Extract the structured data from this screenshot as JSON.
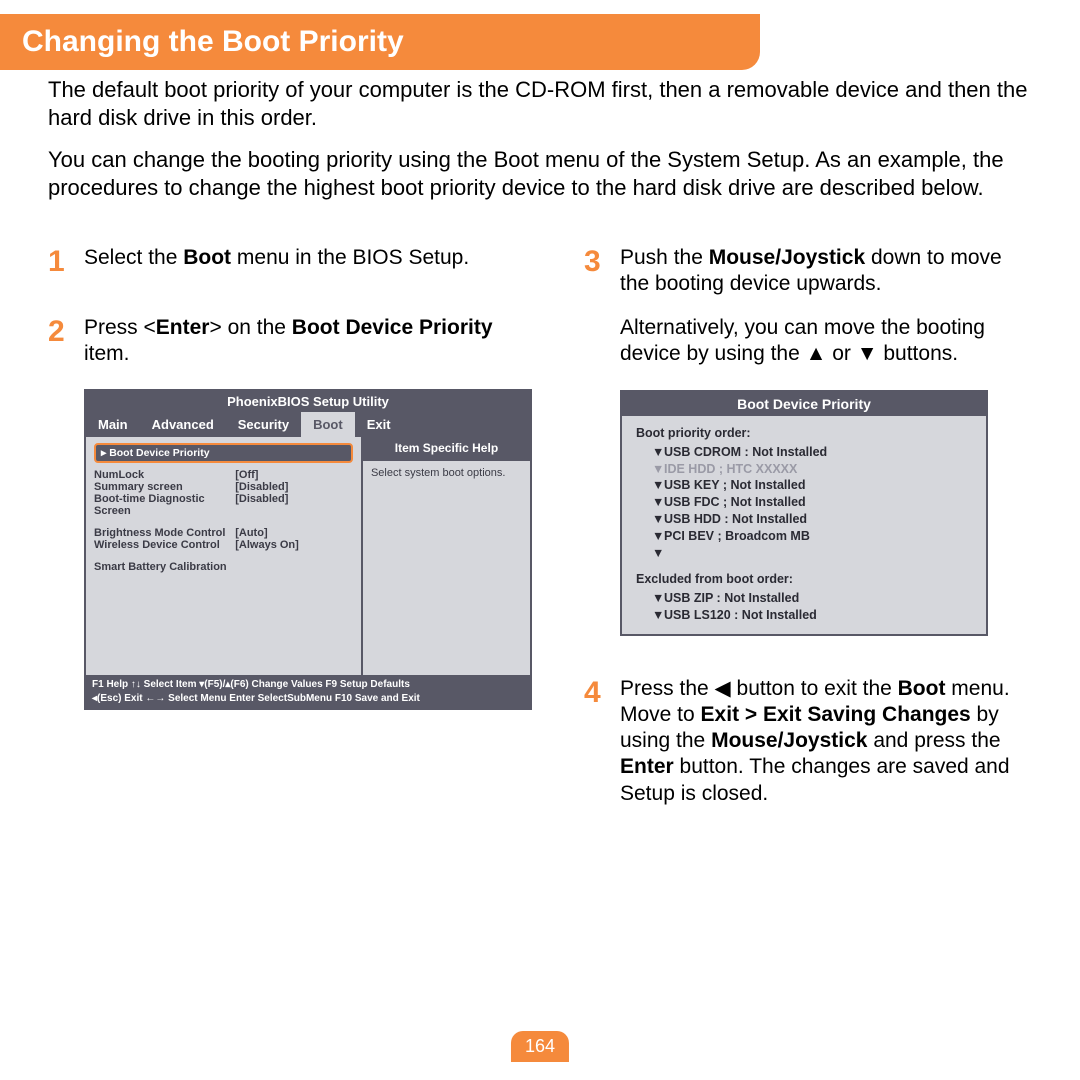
{
  "title": "Changing the Boot Priority",
  "intro": {
    "p1": "The default boot priority of your computer is the CD-ROM first, then a removable device and then the hard disk drive in this order.",
    "p2": "You can change the booting priority using the Boot menu of the System Setup. As an example, the procedures to change the highest boot priority device to the hard disk drive are described below."
  },
  "steps": {
    "s1": {
      "num": "1",
      "t_a": "Select the ",
      "t_b": "Boot",
      "t_c": " menu in the BIOS Setup."
    },
    "s2": {
      "num": "2",
      "t_a": "Press <",
      "t_b": "Enter",
      "t_c": "> on the ",
      "t_d": "Boot Device Priority",
      "t_e": " item."
    },
    "s3": {
      "num": "3",
      "p1_a": "Push the ",
      "p1_b": "Mouse/Joystick",
      "p1_c": " down to move the booting device upwards.",
      "p2": "Alternatively, you can move the booting device by using the ▲ or ▼ buttons."
    },
    "s4": {
      "num": "4",
      "t_a": "Press the ◀ button to exit the ",
      "t_b": "Boot",
      "t_c": " menu. Move to ",
      "t_d": "Exit > Exit Saving Changes",
      "t_e": " by using the ",
      "t_f": "Mouse/Joystick",
      "t_g": " and press the ",
      "t_h": "Enter",
      "t_i": " button. The changes are saved and Setup is closed."
    }
  },
  "bios": {
    "title": "PhoenixBIOS Setup Utility",
    "tabs": [
      "Main",
      "Advanced",
      "Security",
      "Boot",
      "Exit"
    ],
    "selected": "▸ Boot Device Priority",
    "rows": [
      {
        "lab": "NumLock",
        "val": "[Off]"
      },
      {
        "lab": "Summary screen",
        "val": "[Disabled]"
      },
      {
        "lab": "Boot-time Diagnostic Screen",
        "val": "[Disabled]"
      }
    ],
    "rows2": [
      {
        "lab": "Brightness Mode Control",
        "val": "[Auto]"
      },
      {
        "lab": "Wireless Device Control",
        "val": "[Always On]"
      }
    ],
    "rows3": [
      {
        "lab": "Smart Battery Calibration",
        "val": ""
      }
    ],
    "help_title": "Item Specific Help",
    "help_body": "Select system boot options.",
    "footer": {
      "l1": "F1   Help    ↑↓   Select Item    ▾(F5)/▴(F6)  Change Values     F9    Setup Defaults",
      "l2": "◂(Esc) Exit    ←→  Select Menu   Enter          SelectSubMenu    F10  Save and Exit"
    }
  },
  "prio": {
    "title": "Boot Device Priority",
    "hdr1": "Boot priority order:",
    "items": [
      "USB CDROM : Not Installed",
      "IDE HDD ; HTC XXXXX",
      "USB KEY ; Not Installed",
      "USB FDC ; Not Installed",
      "USB HDD : Not Installed",
      "PCI BEV ; Broadcom MB",
      ""
    ],
    "hdr2": "Excluded from boot order:",
    "excluded": [
      "USB ZIP : Not Installed",
      "USB LS120 : Not Installed"
    ]
  },
  "page": "164"
}
